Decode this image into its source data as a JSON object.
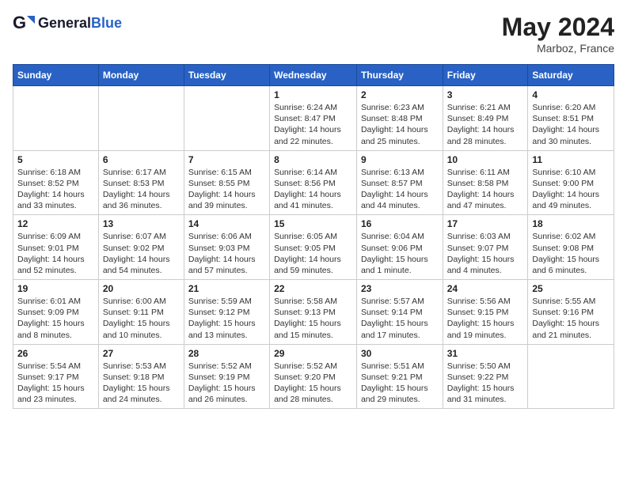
{
  "logo": {
    "line1": "General",
    "line2": "Blue"
  },
  "title": "May 2024",
  "subtitle": "Marboz, France",
  "days_header": [
    "Sunday",
    "Monday",
    "Tuesday",
    "Wednesday",
    "Thursday",
    "Friday",
    "Saturday"
  ],
  "weeks": [
    [
      {
        "num": "",
        "detail": ""
      },
      {
        "num": "",
        "detail": ""
      },
      {
        "num": "",
        "detail": ""
      },
      {
        "num": "1",
        "detail": "Sunrise: 6:24 AM\nSunset: 8:47 PM\nDaylight: 14 hours\nand 22 minutes."
      },
      {
        "num": "2",
        "detail": "Sunrise: 6:23 AM\nSunset: 8:48 PM\nDaylight: 14 hours\nand 25 minutes."
      },
      {
        "num": "3",
        "detail": "Sunrise: 6:21 AM\nSunset: 8:49 PM\nDaylight: 14 hours\nand 28 minutes."
      },
      {
        "num": "4",
        "detail": "Sunrise: 6:20 AM\nSunset: 8:51 PM\nDaylight: 14 hours\nand 30 minutes."
      }
    ],
    [
      {
        "num": "5",
        "detail": "Sunrise: 6:18 AM\nSunset: 8:52 PM\nDaylight: 14 hours\nand 33 minutes."
      },
      {
        "num": "6",
        "detail": "Sunrise: 6:17 AM\nSunset: 8:53 PM\nDaylight: 14 hours\nand 36 minutes."
      },
      {
        "num": "7",
        "detail": "Sunrise: 6:15 AM\nSunset: 8:55 PM\nDaylight: 14 hours\nand 39 minutes."
      },
      {
        "num": "8",
        "detail": "Sunrise: 6:14 AM\nSunset: 8:56 PM\nDaylight: 14 hours\nand 41 minutes."
      },
      {
        "num": "9",
        "detail": "Sunrise: 6:13 AM\nSunset: 8:57 PM\nDaylight: 14 hours\nand 44 minutes."
      },
      {
        "num": "10",
        "detail": "Sunrise: 6:11 AM\nSunset: 8:58 PM\nDaylight: 14 hours\nand 47 minutes."
      },
      {
        "num": "11",
        "detail": "Sunrise: 6:10 AM\nSunset: 9:00 PM\nDaylight: 14 hours\nand 49 minutes."
      }
    ],
    [
      {
        "num": "12",
        "detail": "Sunrise: 6:09 AM\nSunset: 9:01 PM\nDaylight: 14 hours\nand 52 minutes."
      },
      {
        "num": "13",
        "detail": "Sunrise: 6:07 AM\nSunset: 9:02 PM\nDaylight: 14 hours\nand 54 minutes."
      },
      {
        "num": "14",
        "detail": "Sunrise: 6:06 AM\nSunset: 9:03 PM\nDaylight: 14 hours\nand 57 minutes."
      },
      {
        "num": "15",
        "detail": "Sunrise: 6:05 AM\nSunset: 9:05 PM\nDaylight: 14 hours\nand 59 minutes."
      },
      {
        "num": "16",
        "detail": "Sunrise: 6:04 AM\nSunset: 9:06 PM\nDaylight: 15 hours\nand 1 minute."
      },
      {
        "num": "17",
        "detail": "Sunrise: 6:03 AM\nSunset: 9:07 PM\nDaylight: 15 hours\nand 4 minutes."
      },
      {
        "num": "18",
        "detail": "Sunrise: 6:02 AM\nSunset: 9:08 PM\nDaylight: 15 hours\nand 6 minutes."
      }
    ],
    [
      {
        "num": "19",
        "detail": "Sunrise: 6:01 AM\nSunset: 9:09 PM\nDaylight: 15 hours\nand 8 minutes."
      },
      {
        "num": "20",
        "detail": "Sunrise: 6:00 AM\nSunset: 9:11 PM\nDaylight: 15 hours\nand 10 minutes."
      },
      {
        "num": "21",
        "detail": "Sunrise: 5:59 AM\nSunset: 9:12 PM\nDaylight: 15 hours\nand 13 minutes."
      },
      {
        "num": "22",
        "detail": "Sunrise: 5:58 AM\nSunset: 9:13 PM\nDaylight: 15 hours\nand 15 minutes."
      },
      {
        "num": "23",
        "detail": "Sunrise: 5:57 AM\nSunset: 9:14 PM\nDaylight: 15 hours\nand 17 minutes."
      },
      {
        "num": "24",
        "detail": "Sunrise: 5:56 AM\nSunset: 9:15 PM\nDaylight: 15 hours\nand 19 minutes."
      },
      {
        "num": "25",
        "detail": "Sunrise: 5:55 AM\nSunset: 9:16 PM\nDaylight: 15 hours\nand 21 minutes."
      }
    ],
    [
      {
        "num": "26",
        "detail": "Sunrise: 5:54 AM\nSunset: 9:17 PM\nDaylight: 15 hours\nand 23 minutes."
      },
      {
        "num": "27",
        "detail": "Sunrise: 5:53 AM\nSunset: 9:18 PM\nDaylight: 15 hours\nand 24 minutes."
      },
      {
        "num": "28",
        "detail": "Sunrise: 5:52 AM\nSunset: 9:19 PM\nDaylight: 15 hours\nand 26 minutes."
      },
      {
        "num": "29",
        "detail": "Sunrise: 5:52 AM\nSunset: 9:20 PM\nDaylight: 15 hours\nand 28 minutes."
      },
      {
        "num": "30",
        "detail": "Sunrise: 5:51 AM\nSunset: 9:21 PM\nDaylight: 15 hours\nand 29 minutes."
      },
      {
        "num": "31",
        "detail": "Sunrise: 5:50 AM\nSunset: 9:22 PM\nDaylight: 15 hours\nand 31 minutes."
      },
      {
        "num": "",
        "detail": ""
      }
    ]
  ]
}
